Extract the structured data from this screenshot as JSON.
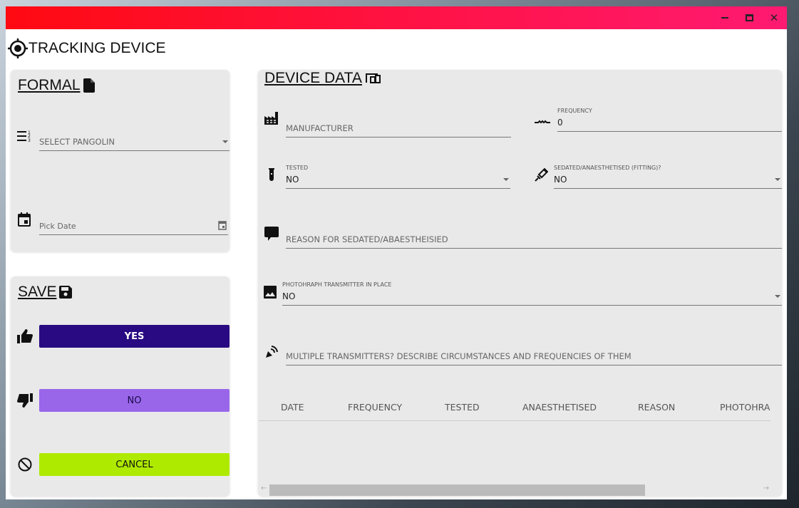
{
  "window": {
    "title": "TRACKING DEVICE",
    "controls": [
      "minimize",
      "maximize",
      "close"
    ]
  },
  "formal": {
    "heading": "FORMAL",
    "pangolin_placeholder": "SELECT PANGOLIN",
    "date_placeholder": "Pick Date"
  },
  "save": {
    "heading": "SAVE",
    "yes": "YES",
    "no": "NO",
    "cancel": "CANCEL"
  },
  "device": {
    "heading": "DEVICE DATA",
    "manufacturer_placeholder": "MANUFACTURER",
    "frequency_label": "FREQUENCY",
    "frequency_value": "0",
    "tested_label": "TESTED",
    "tested_value": "NO",
    "sedated_label": "SEDATED/ANAESTHETISED (FITTING)?",
    "sedated_value": "NO",
    "reason_placeholder": "REASON FOR SEDATED/ABAESTHEISIED",
    "photo_label": "PHOTOHRAPH TRANSMITTER IN PLACE",
    "photo_value": "NO",
    "multiple_placeholder": "MULTIPLE TRANSMITTERS? DESCRIBE CIRCUMSTANCES AND FREQUENCIES OF THEM"
  },
  "table": {
    "columns": [
      "DATE",
      "FREQUENCY",
      "TESTED",
      "ANAESTHETISED",
      "REASON",
      "PHOTOHRA"
    ]
  },
  "colors": {
    "yes": "#2a0a82",
    "no": "#9966ea",
    "cancel": "#aeea00",
    "titlebar_start": "#ff0a12",
    "titlebar_end": "#ff1a72"
  }
}
